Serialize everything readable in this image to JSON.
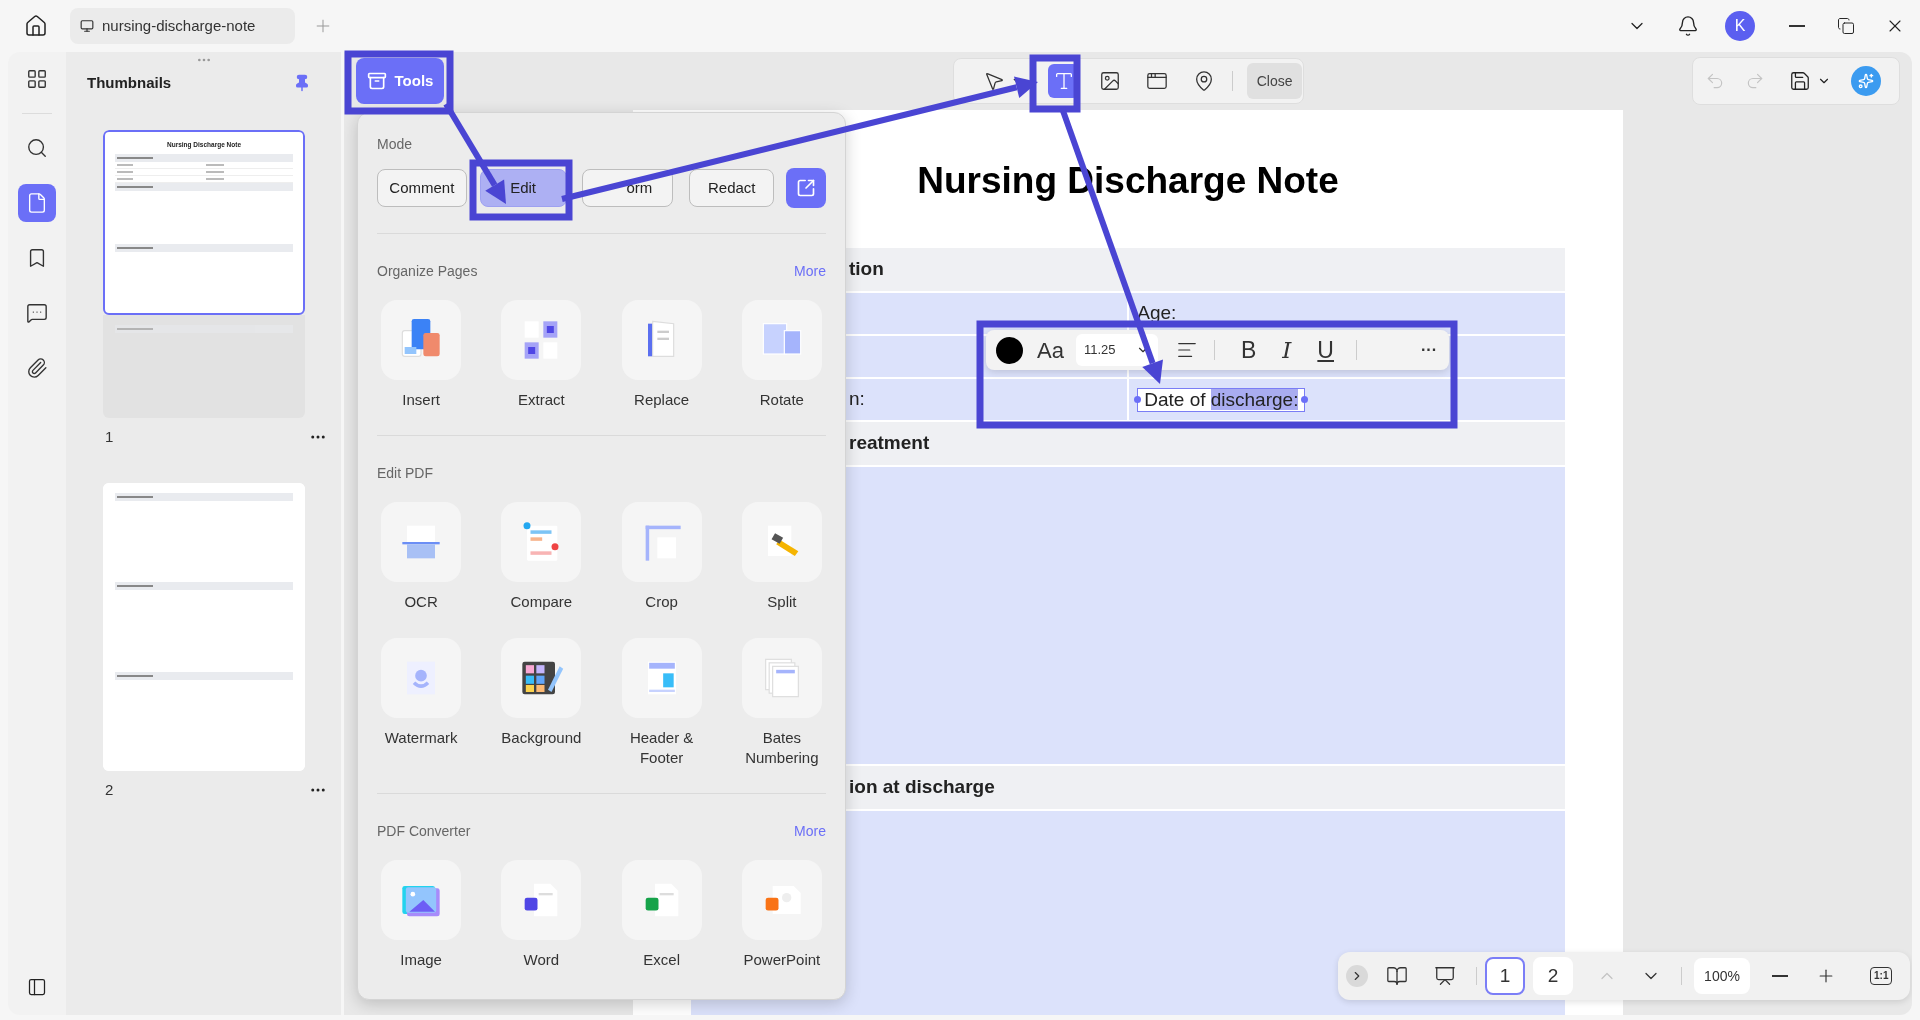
{
  "tab_bar": {
    "tab_title": "nursing-discharge-note",
    "avatar": "K"
  },
  "rail": [
    {
      "kind": "grid",
      "selected": false
    },
    {
      "kind": "search",
      "selected": false
    },
    {
      "kind": "pages",
      "selected": true
    },
    {
      "kind": "bookmark",
      "selected": false
    },
    {
      "kind": "comment",
      "selected": false
    },
    {
      "kind": "attachment",
      "selected": false
    }
  ],
  "thumbnails": {
    "title": "Thumbnails",
    "pages": [
      {
        "number": "1",
        "selected": true,
        "title": "Nursing Discharge Note",
        "blocks": [
          {
            "kind": "table",
            "dimmed": false
          },
          {
            "kind": "section",
            "dimmed": false
          },
          {
            "kind": "section",
            "dimmed": false
          },
          {
            "kind": "section",
            "dimmed": true
          }
        ]
      },
      {
        "number": "2",
        "selected": false,
        "blocks": [
          {
            "kind": "section",
            "dimmed": false
          },
          {
            "kind": "section",
            "dimmed": false
          },
          {
            "kind": "section",
            "dimmed": false
          }
        ]
      }
    ]
  },
  "tools_button": "Tools",
  "toolbar": {
    "tools": [
      {
        "kind": "select",
        "selected": false
      },
      {
        "kind": "text",
        "selected": true
      },
      {
        "kind": "image",
        "selected": false
      },
      {
        "kind": "link",
        "selected": false
      },
      {
        "kind": "area",
        "selected": false
      }
    ],
    "close": "Close"
  },
  "history": [
    {
      "kind": "undo",
      "disabled": true
    },
    {
      "kind": "redo",
      "disabled": true
    }
  ],
  "popup": {
    "mode_title": "Mode",
    "modes": [
      {
        "label": "Comment",
        "selected": false
      },
      {
        "label": "Edit",
        "selected": true
      },
      {
        "label": "orm",
        "selected": false
      },
      {
        "label": "Redact",
        "selected": false
      }
    ],
    "sections": [
      {
        "title": "Organize Pages",
        "more": "More",
        "tools": [
          "Insert",
          "Extract",
          "Replace",
          "Rotate"
        ]
      },
      {
        "title": "Edit PDF",
        "tools": [
          "OCR",
          "Compare",
          "Crop",
          "Split",
          "Watermark",
          "Background",
          "Header & Footer",
          "Bates Numbering"
        ]
      },
      {
        "title": "PDF Converter",
        "more": "More",
        "tools": [
          "Image",
          "Word",
          "Excel",
          "PowerPoint"
        ]
      }
    ]
  },
  "document": {
    "title": "Nursing Discharge Note",
    "rows": [
      {
        "kind": "header",
        "text": "tion"
      },
      {
        "kind": "pair",
        "right": "Age:"
      },
      {
        "kind": "pair"
      },
      {
        "kind": "pair",
        "left": "n:",
        "right": "Date of ",
        "selection": "discharge:",
        "editing": true
      },
      {
        "kind": "header",
        "text": "reatment"
      },
      {
        "kind": "body"
      },
      {
        "kind": "header",
        "text": "ion at discharge"
      },
      {
        "kind": "body"
      }
    ]
  },
  "format_toolbar": {
    "font": "Aa",
    "size": "11.25",
    "styles": [
      {
        "kind": "bold",
        "label": "B"
      },
      {
        "kind": "italic",
        "label": "I"
      },
      {
        "kind": "underline",
        "label": "U"
      }
    ],
    "more": "···"
  },
  "bottom_bar": {
    "pages": [
      {
        "label": "1",
        "selected": true
      },
      {
        "label": "2",
        "selected": false
      }
    ],
    "nav": [
      {
        "kind": "up",
        "disabled": true
      },
      {
        "kind": "down",
        "disabled": false
      }
    ],
    "zoom": "100%",
    "fit": "1:1"
  }
}
